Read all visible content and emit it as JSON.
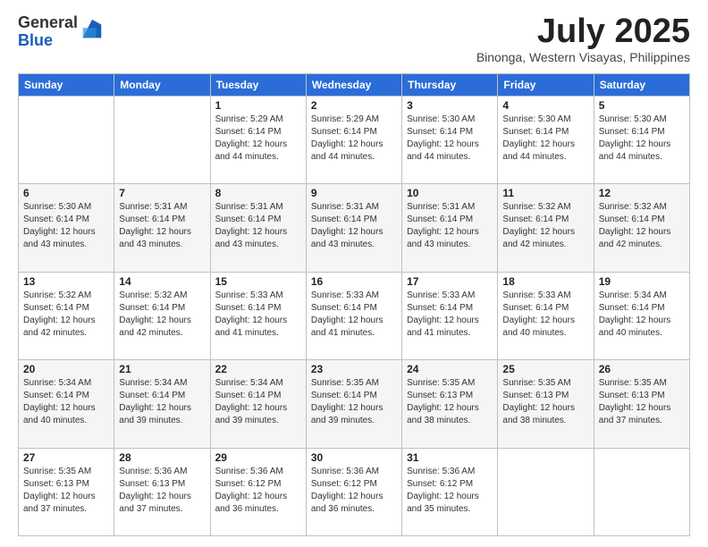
{
  "logo": {
    "general": "General",
    "blue": "Blue"
  },
  "header": {
    "month_title": "July 2025",
    "subtitle": "Binonga, Western Visayas, Philippines"
  },
  "days_of_week": [
    "Sunday",
    "Monday",
    "Tuesday",
    "Wednesday",
    "Thursday",
    "Friday",
    "Saturday"
  ],
  "weeks": [
    [
      {
        "day": "",
        "info": ""
      },
      {
        "day": "",
        "info": ""
      },
      {
        "day": "1",
        "info": "Sunrise: 5:29 AM\nSunset: 6:14 PM\nDaylight: 12 hours and 44 minutes."
      },
      {
        "day": "2",
        "info": "Sunrise: 5:29 AM\nSunset: 6:14 PM\nDaylight: 12 hours and 44 minutes."
      },
      {
        "day": "3",
        "info": "Sunrise: 5:30 AM\nSunset: 6:14 PM\nDaylight: 12 hours and 44 minutes."
      },
      {
        "day": "4",
        "info": "Sunrise: 5:30 AM\nSunset: 6:14 PM\nDaylight: 12 hours and 44 minutes."
      },
      {
        "day": "5",
        "info": "Sunrise: 5:30 AM\nSunset: 6:14 PM\nDaylight: 12 hours and 44 minutes."
      }
    ],
    [
      {
        "day": "6",
        "info": "Sunrise: 5:30 AM\nSunset: 6:14 PM\nDaylight: 12 hours and 43 minutes."
      },
      {
        "day": "7",
        "info": "Sunrise: 5:31 AM\nSunset: 6:14 PM\nDaylight: 12 hours and 43 minutes."
      },
      {
        "day": "8",
        "info": "Sunrise: 5:31 AM\nSunset: 6:14 PM\nDaylight: 12 hours and 43 minutes."
      },
      {
        "day": "9",
        "info": "Sunrise: 5:31 AM\nSunset: 6:14 PM\nDaylight: 12 hours and 43 minutes."
      },
      {
        "day": "10",
        "info": "Sunrise: 5:31 AM\nSunset: 6:14 PM\nDaylight: 12 hours and 43 minutes."
      },
      {
        "day": "11",
        "info": "Sunrise: 5:32 AM\nSunset: 6:14 PM\nDaylight: 12 hours and 42 minutes."
      },
      {
        "day": "12",
        "info": "Sunrise: 5:32 AM\nSunset: 6:14 PM\nDaylight: 12 hours and 42 minutes."
      }
    ],
    [
      {
        "day": "13",
        "info": "Sunrise: 5:32 AM\nSunset: 6:14 PM\nDaylight: 12 hours and 42 minutes."
      },
      {
        "day": "14",
        "info": "Sunrise: 5:32 AM\nSunset: 6:14 PM\nDaylight: 12 hours and 42 minutes."
      },
      {
        "day": "15",
        "info": "Sunrise: 5:33 AM\nSunset: 6:14 PM\nDaylight: 12 hours and 41 minutes."
      },
      {
        "day": "16",
        "info": "Sunrise: 5:33 AM\nSunset: 6:14 PM\nDaylight: 12 hours and 41 minutes."
      },
      {
        "day": "17",
        "info": "Sunrise: 5:33 AM\nSunset: 6:14 PM\nDaylight: 12 hours and 41 minutes."
      },
      {
        "day": "18",
        "info": "Sunrise: 5:33 AM\nSunset: 6:14 PM\nDaylight: 12 hours and 40 minutes."
      },
      {
        "day": "19",
        "info": "Sunrise: 5:34 AM\nSunset: 6:14 PM\nDaylight: 12 hours and 40 minutes."
      }
    ],
    [
      {
        "day": "20",
        "info": "Sunrise: 5:34 AM\nSunset: 6:14 PM\nDaylight: 12 hours and 40 minutes."
      },
      {
        "day": "21",
        "info": "Sunrise: 5:34 AM\nSunset: 6:14 PM\nDaylight: 12 hours and 39 minutes."
      },
      {
        "day": "22",
        "info": "Sunrise: 5:34 AM\nSunset: 6:14 PM\nDaylight: 12 hours and 39 minutes."
      },
      {
        "day": "23",
        "info": "Sunrise: 5:35 AM\nSunset: 6:14 PM\nDaylight: 12 hours and 39 minutes."
      },
      {
        "day": "24",
        "info": "Sunrise: 5:35 AM\nSunset: 6:13 PM\nDaylight: 12 hours and 38 minutes."
      },
      {
        "day": "25",
        "info": "Sunrise: 5:35 AM\nSunset: 6:13 PM\nDaylight: 12 hours and 38 minutes."
      },
      {
        "day": "26",
        "info": "Sunrise: 5:35 AM\nSunset: 6:13 PM\nDaylight: 12 hours and 37 minutes."
      }
    ],
    [
      {
        "day": "27",
        "info": "Sunrise: 5:35 AM\nSunset: 6:13 PM\nDaylight: 12 hours and 37 minutes."
      },
      {
        "day": "28",
        "info": "Sunrise: 5:36 AM\nSunset: 6:13 PM\nDaylight: 12 hours and 37 minutes."
      },
      {
        "day": "29",
        "info": "Sunrise: 5:36 AM\nSunset: 6:12 PM\nDaylight: 12 hours and 36 minutes."
      },
      {
        "day": "30",
        "info": "Sunrise: 5:36 AM\nSunset: 6:12 PM\nDaylight: 12 hours and 36 minutes."
      },
      {
        "day": "31",
        "info": "Sunrise: 5:36 AM\nSunset: 6:12 PM\nDaylight: 12 hours and 35 minutes."
      },
      {
        "day": "",
        "info": ""
      },
      {
        "day": "",
        "info": ""
      }
    ]
  ]
}
